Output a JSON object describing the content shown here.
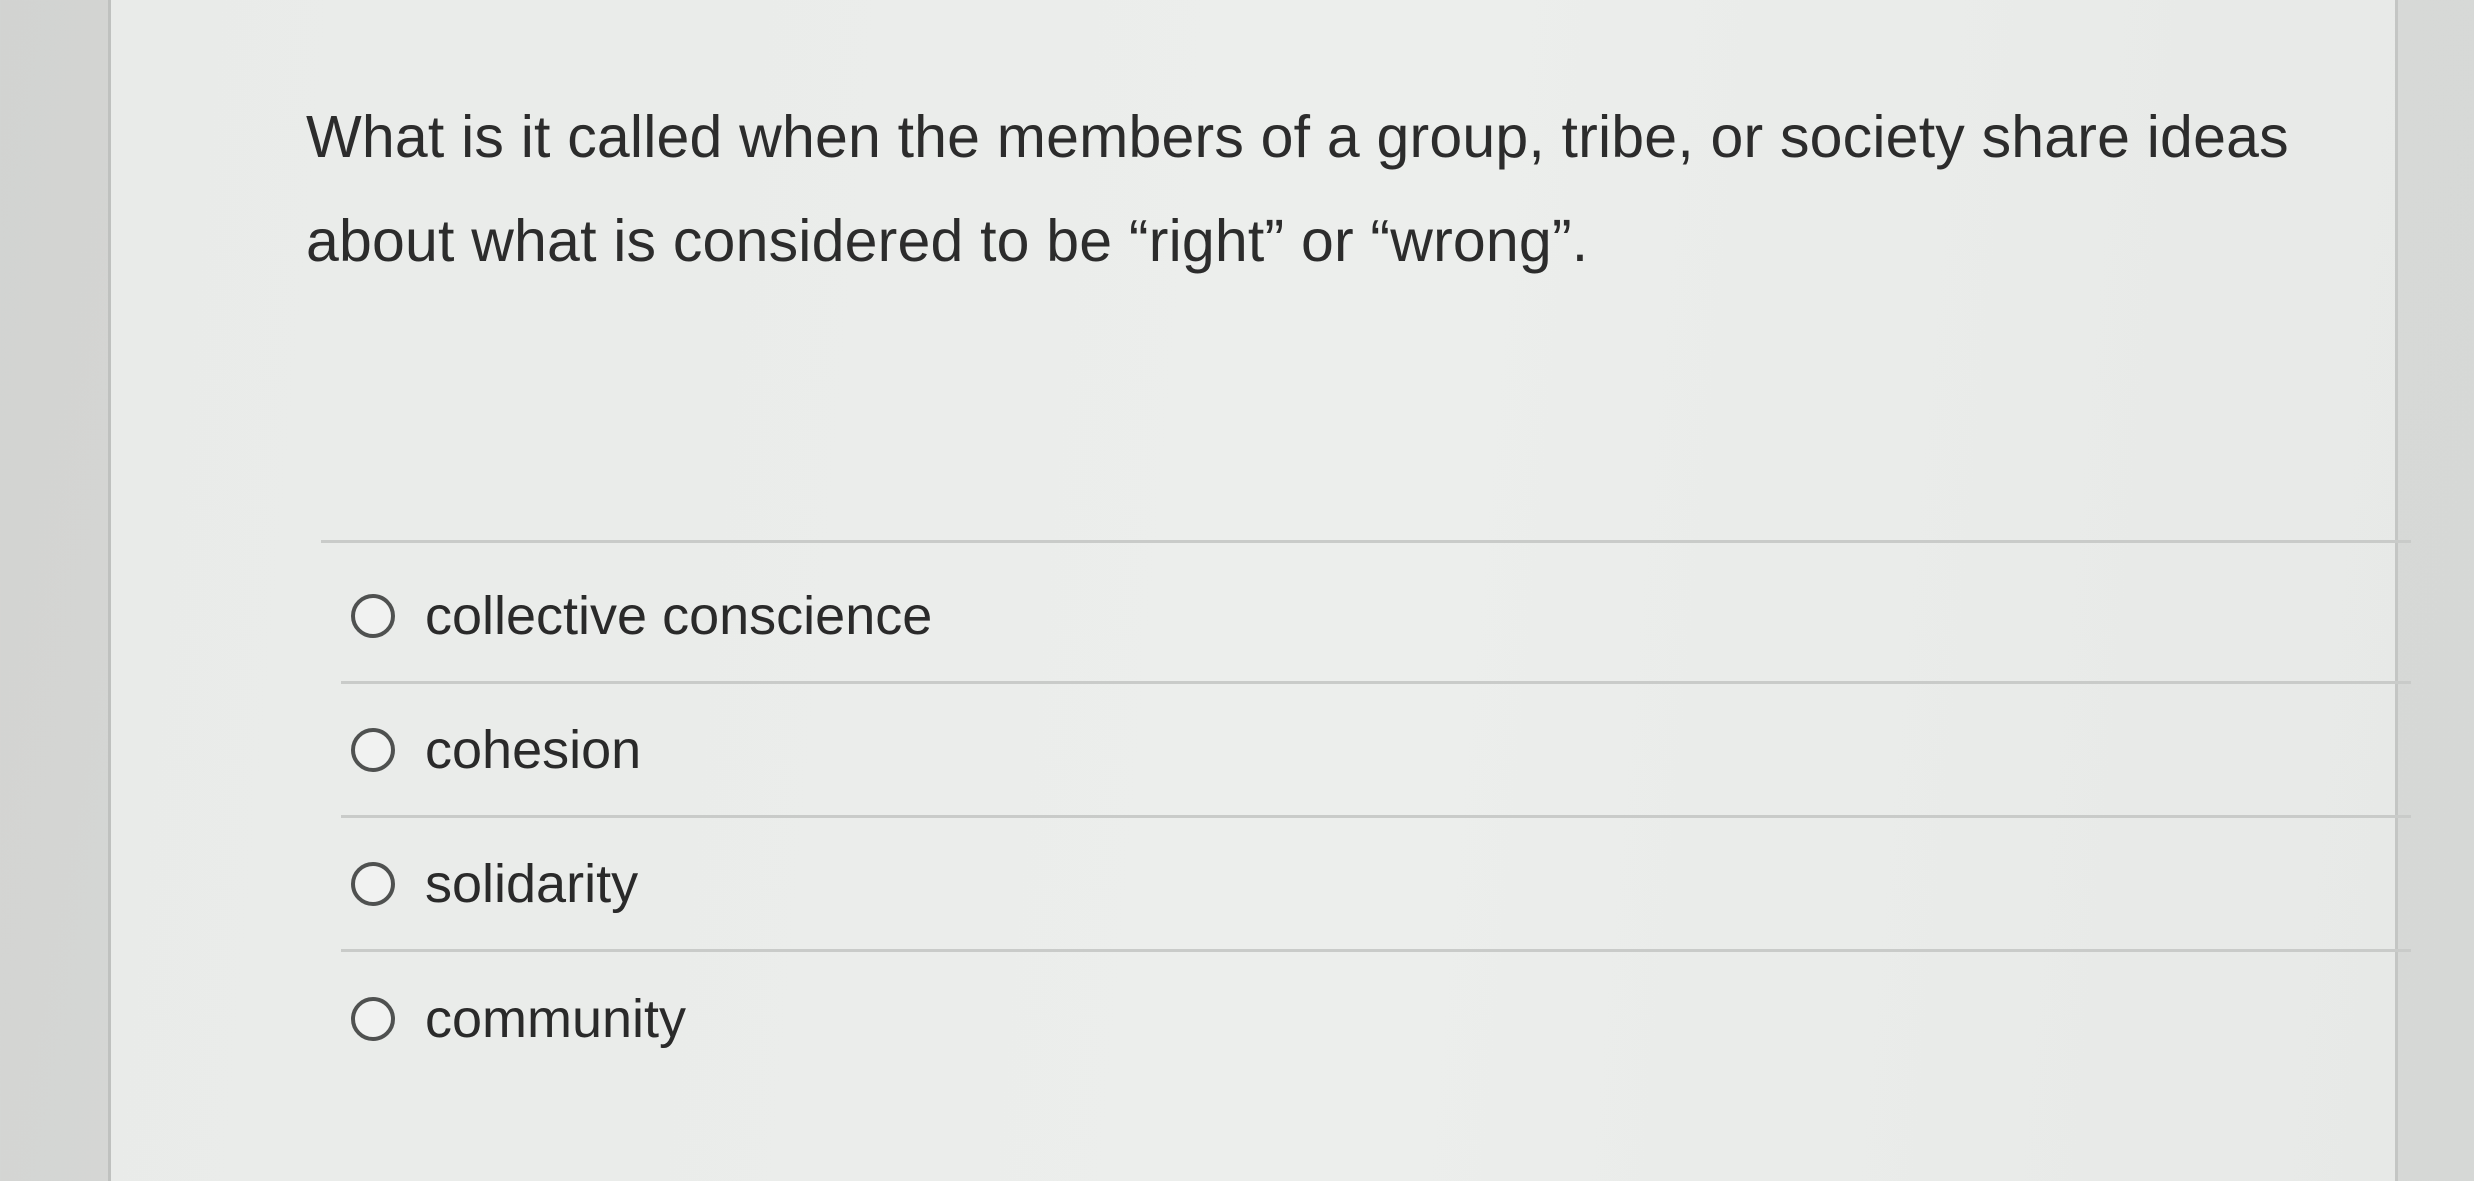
{
  "question": {
    "lines": [
      "What is it called when the members of a group, tribe, or society share ideas",
      "about what is considered to be “right” or “wrong”."
    ]
  },
  "answers": [
    {
      "label": "collective conscience",
      "selected": false
    },
    {
      "label": "cohesion",
      "selected": false
    },
    {
      "label": "solidarity",
      "selected": false
    },
    {
      "label": "community",
      "selected": false
    }
  ]
}
